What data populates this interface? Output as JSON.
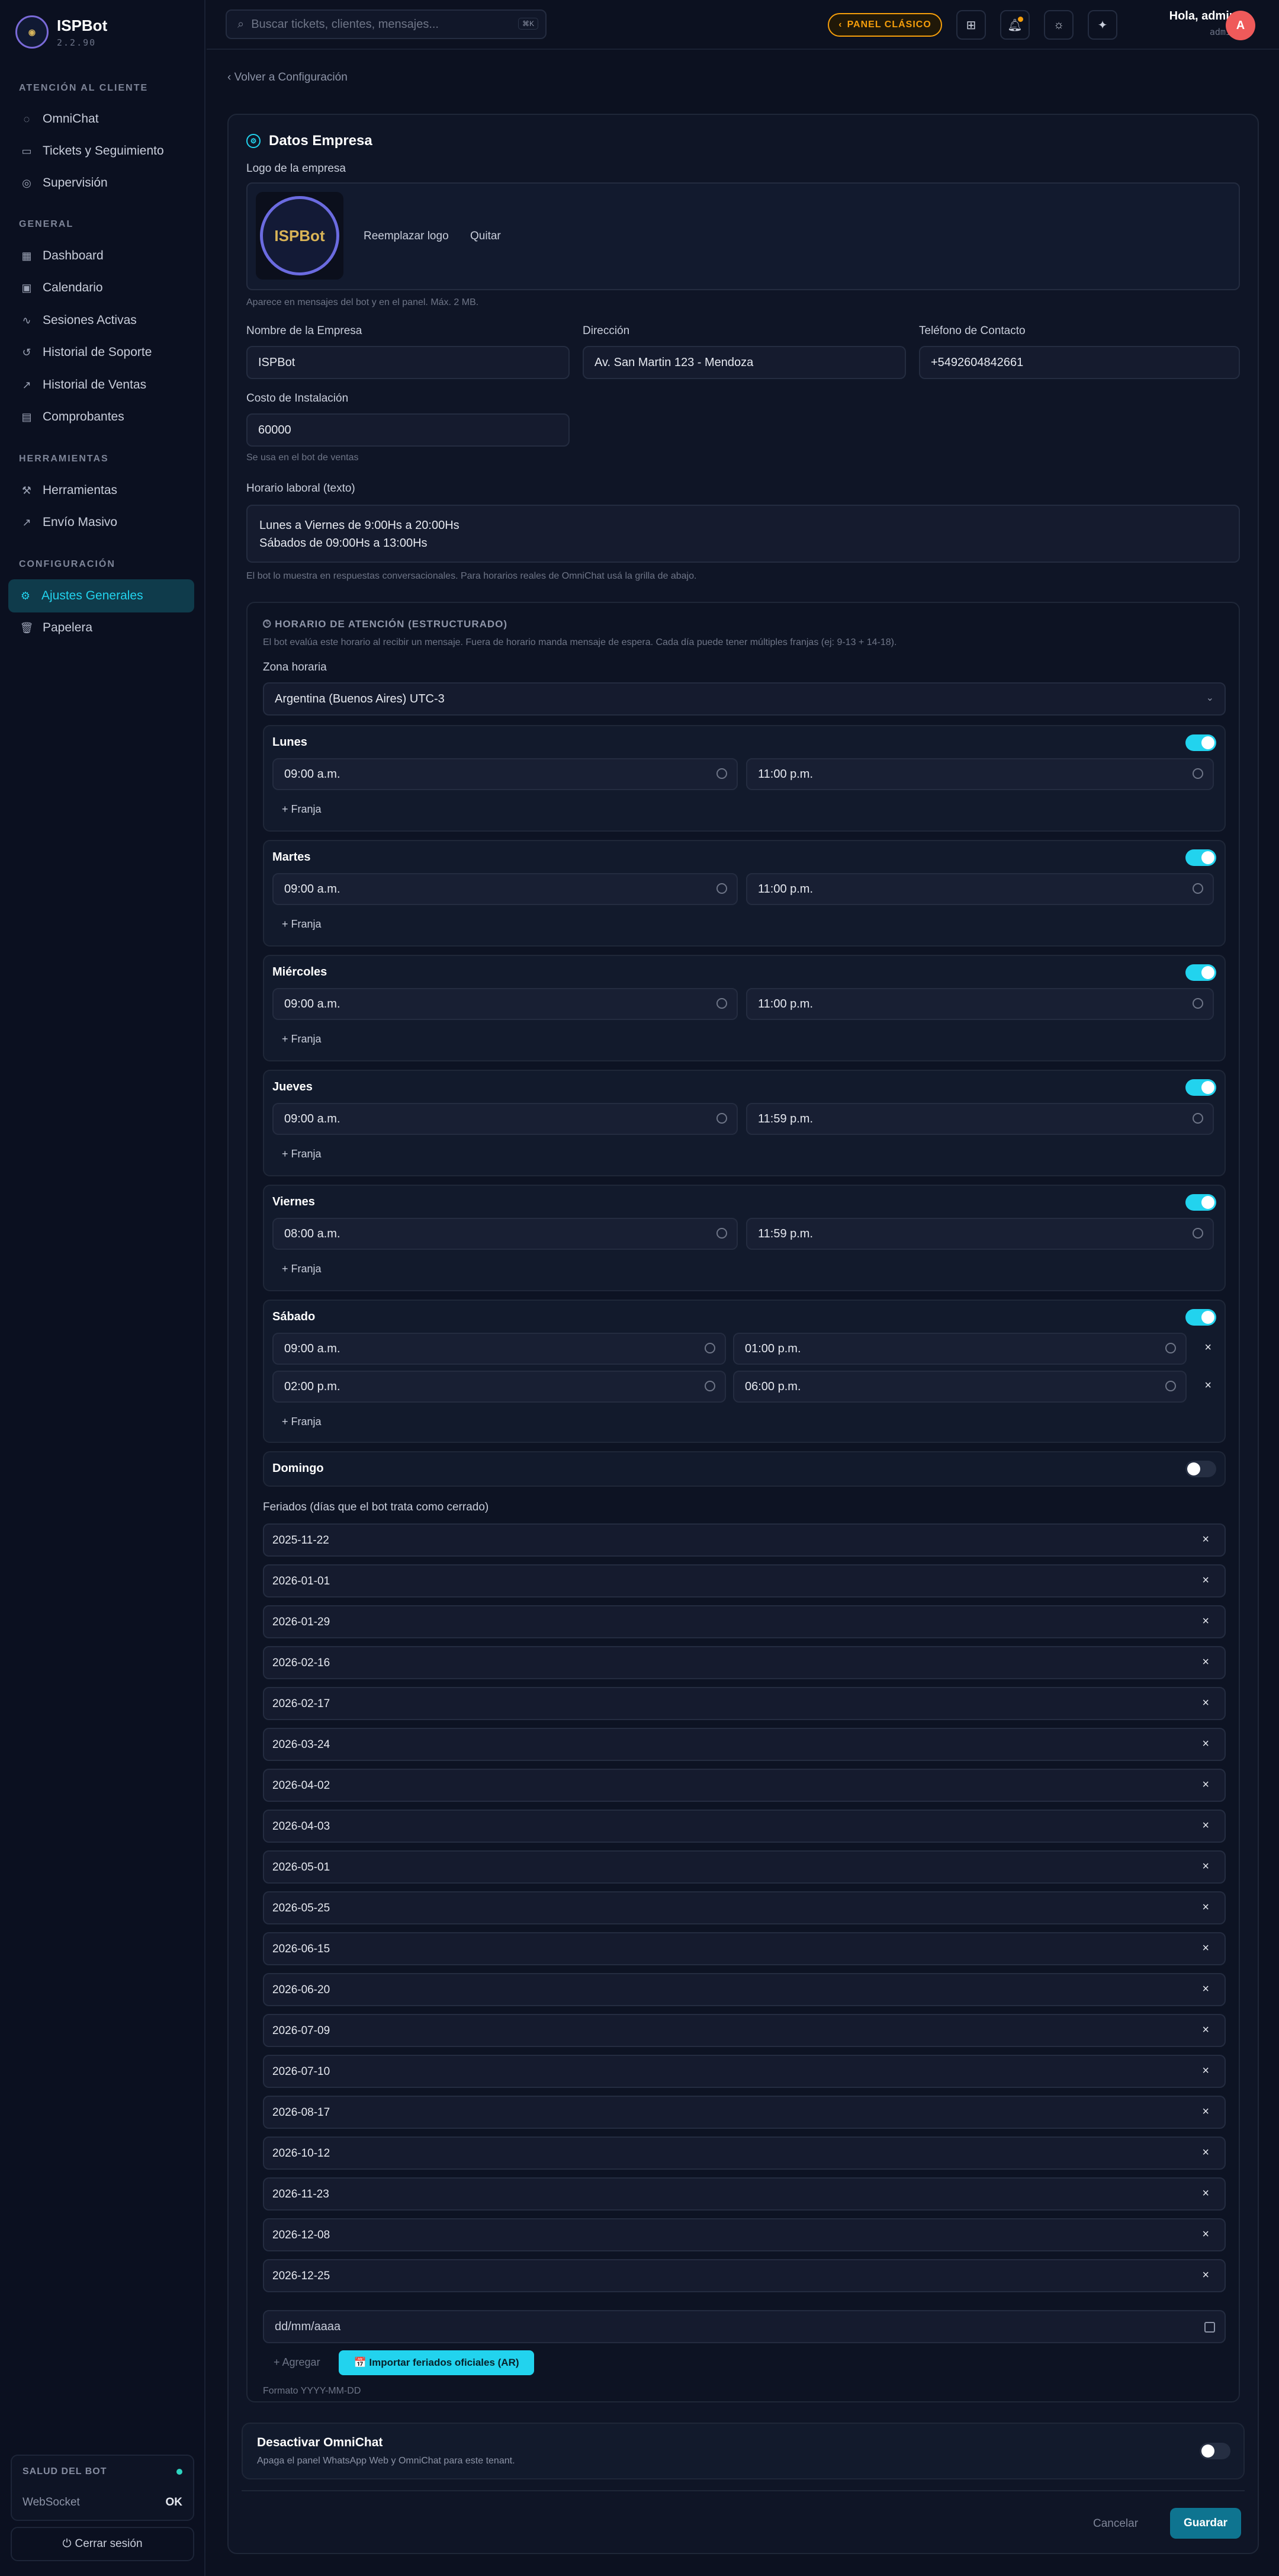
{
  "brand": {
    "name": "ISPBot",
    "version": "2.2.90",
    "logo_text": "ISPBot"
  },
  "sidebar": {
    "sections": [
      {
        "label": "ATENCIÓN AL CLIENTE"
      },
      {
        "label": "GENERAL"
      },
      {
        "label": "HERRAMIENTAS"
      },
      {
        "label": "CONFIGURACIÓN"
      }
    ],
    "items": [
      {
        "label": "OmniChat",
        "icon": "chat-icon"
      },
      {
        "label": "Tickets y Seguimiento",
        "icon": "ticket-icon"
      },
      {
        "label": "Supervisión",
        "icon": "eye-icon"
      },
      {
        "label": "Dashboard",
        "icon": "grid-icon"
      },
      {
        "label": "Calendario",
        "icon": "calendar-icon"
      },
      {
        "label": "Sesiones Activas",
        "icon": "activity-icon"
      },
      {
        "label": "Historial de Soporte",
        "icon": "history-icon"
      },
      {
        "label": "Historial de Ventas",
        "icon": "trend-icon"
      },
      {
        "label": "Comprobantes",
        "icon": "receipt-icon"
      },
      {
        "label": "Herramientas",
        "icon": "wrench-icon"
      },
      {
        "label": "Envío Masivo",
        "icon": "send-icon"
      },
      {
        "label": "Ajustes Generales",
        "icon": "gear-icon",
        "active": true
      },
      {
        "label": "Papelera",
        "icon": "trash-icon"
      }
    ],
    "health": {
      "title": "SALUD DEL BOT",
      "ws_label": "WebSocket",
      "ws_status": "OK",
      "status_color": "#2dd4bf"
    },
    "logout": "Cerrar sesión"
  },
  "topbar": {
    "search_placeholder": "Buscar tickets, clientes, mensajes...",
    "search_shortcut": "⌘K",
    "classic_panel": "PANEL CLÁSICO",
    "greeting": "Hola, admin",
    "role": "admin",
    "avatar_initial": "A"
  },
  "page": {
    "back": "Volver a Configuración",
    "title": "Datos Empresa",
    "logo_label": "Logo de la empresa",
    "replace_logo": "Reemplazar logo",
    "remove_logo": "Quitar",
    "logo_hint": "Aparece en mensajes del bot y en el panel. Máx. 2 MB.",
    "company_name_label": "Nombre de la Empresa",
    "company_name": "ISPBot",
    "address_label": "Dirección",
    "address": "Av. San Martin 123 - Mendoza",
    "phone_label": "Teléfono de Contacto",
    "phone": "+5492604842661",
    "install_cost_label": "Costo de Instalación",
    "install_cost": "60000",
    "install_cost_hint": "Se usa en el bot de ventas",
    "hours_text_label": "Horario laboral (texto)",
    "hours_text": "Lunes a Viernes de 9:00Hs a 20:00Hs\nSábados de 09:00Hs a 13:00Hs",
    "hours_text_hint": "El bot lo muestra en respuestas conversacionales. Para horarios reales de OmniChat usá la grilla de abajo."
  },
  "schedule": {
    "title": "HORARIO DE ATENCIÓN (ESTRUCTURADO)",
    "description": "El bot evalúa este horario al recibir un mensaje. Fuera de horario manda mensaje de espera. Cada día puede tener múltiples franjas (ej: 9-13 + 14-18).",
    "tz_label": "Zona horaria",
    "tz_value": "Argentina (Buenos Aires) UTC-3",
    "add_slot": "+ Franja",
    "days": [
      {
        "name": "Lunes",
        "enabled": true,
        "slots": [
          [
            "09:00 a.m.",
            "11:00 p.m."
          ]
        ]
      },
      {
        "name": "Martes",
        "enabled": true,
        "slots": [
          [
            "09:00 a.m.",
            "11:00 p.m."
          ]
        ]
      },
      {
        "name": "Miércoles",
        "enabled": true,
        "slots": [
          [
            "09:00 a.m.",
            "11:00 p.m."
          ]
        ]
      },
      {
        "name": "Jueves",
        "enabled": true,
        "slots": [
          [
            "09:00 a.m.",
            "11:59 p.m."
          ]
        ]
      },
      {
        "name": "Viernes",
        "enabled": true,
        "slots": [
          [
            "08:00 a.m.",
            "11:59 p.m."
          ]
        ]
      },
      {
        "name": "Sábado",
        "enabled": true,
        "slots": [
          [
            "09:00 a.m.",
            "01:00 p.m."
          ],
          [
            "02:00 p.m.",
            "06:00 p.m."
          ]
        ]
      },
      {
        "name": "Domingo",
        "enabled": false,
        "slots": []
      }
    ],
    "holidays_label": "Feriados (días que el bot trata como cerrado)",
    "holidays": [
      "2025-11-22",
      "2026-01-01",
      "2026-01-29",
      "2026-02-16",
      "2026-02-17",
      "2026-03-24",
      "2026-04-02",
      "2026-04-03",
      "2026-05-01",
      "2026-05-25",
      "2026-06-15",
      "2026-06-20",
      "2026-07-09",
      "2026-07-10",
      "2026-08-17",
      "2026-10-12",
      "2026-11-23",
      "2026-12-08",
      "2026-12-25"
    ],
    "date_placeholder": "dd/mm/aaaa",
    "add_holiday": "+ Agregar",
    "import_holidays": "📅 Importar feriados oficiales (AR)",
    "format_hint": "Formato YYYY-MM-DD"
  },
  "omnichat": {
    "title": "Desactivar OmniChat",
    "description": "Apaga el panel WhatsApp Web y OmniChat para este tenant.",
    "enabled": false
  },
  "actions": {
    "cancel": "Cancelar",
    "save": "Guardar"
  },
  "colors": {
    "accent": "#22d3ee",
    "warning": "#f59e0b",
    "avatar": "#ef5a5a",
    "save": "#0e7490"
  }
}
